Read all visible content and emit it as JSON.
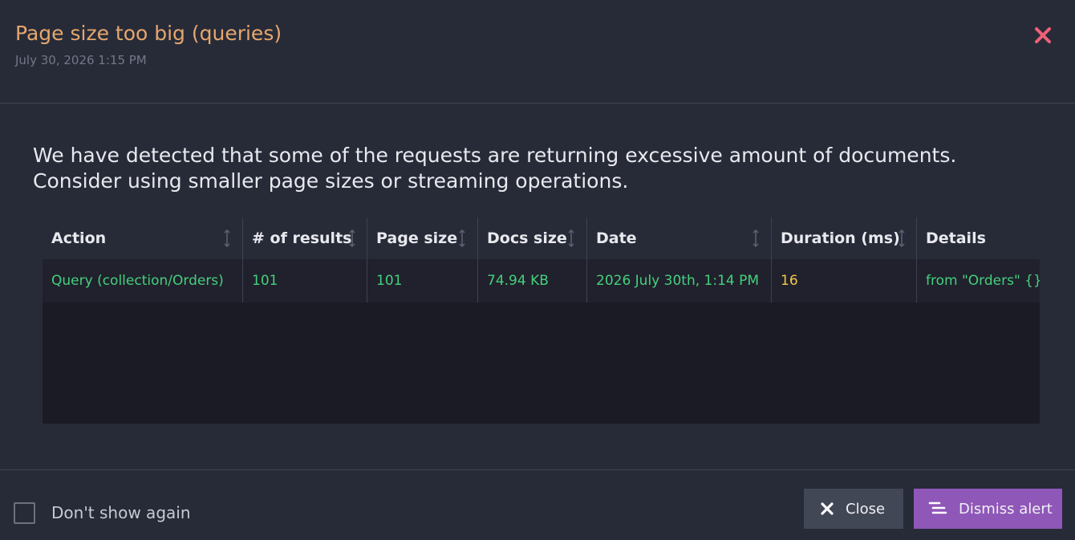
{
  "header": {
    "title": "Page size too big (queries)",
    "timestamp": "July 30, 2026 1:15 PM"
  },
  "message": {
    "line1": "We have detected that some of the requests are returning excessive amount of documents.",
    "line2": "Consider using smaller page sizes or streaming operations."
  },
  "table": {
    "columns": [
      {
        "label": "Action"
      },
      {
        "label": "# of results"
      },
      {
        "label": "Page size"
      },
      {
        "label": "Docs size"
      },
      {
        "label": "Date"
      },
      {
        "label": "Duration (ms)"
      },
      {
        "label": "Details"
      }
    ],
    "rows": [
      {
        "action": "Query (collection/Orders)",
        "results": "101",
        "page_size": "101",
        "docs_size": "74.94 KB",
        "date": "2026 July 30th, 1:14 PM",
        "duration": "16",
        "details": "from \"Orders\" {}"
      }
    ]
  },
  "footer": {
    "dont_show_label": "Don't show again",
    "close_label": "Close",
    "dismiss_label": "Dismiss alert"
  },
  "colors": {
    "title": "#e6a66e",
    "value_green": "#45d07b",
    "value_yellow": "#f4c84a",
    "dismiss_button": "#8f57b8",
    "close_icon": "#f0607a"
  }
}
